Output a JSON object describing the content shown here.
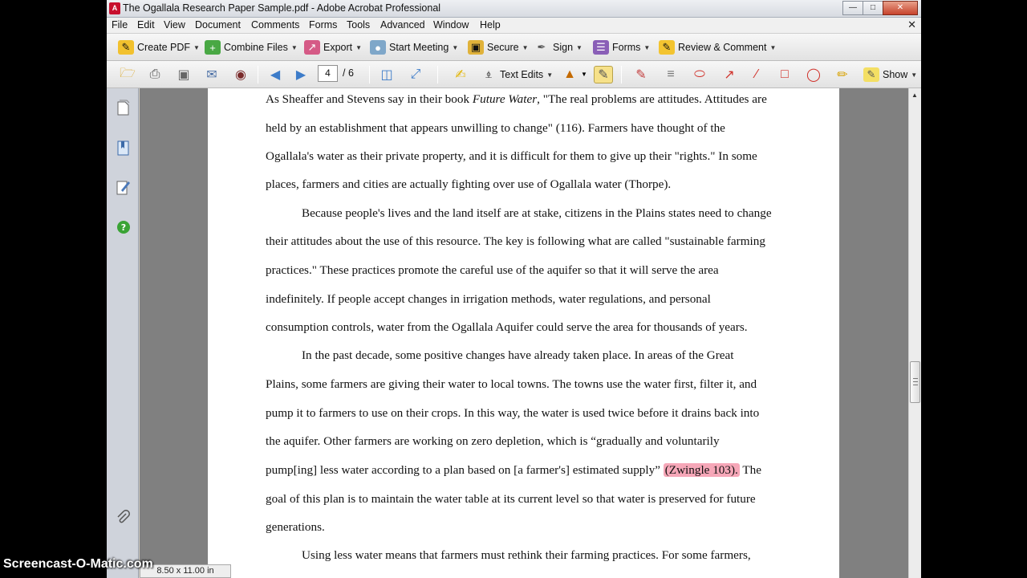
{
  "window": {
    "title": "The Ogallala Research Paper Sample.pdf - Adobe Acrobat Professional"
  },
  "menu": [
    "File",
    "Edit",
    "View",
    "Document",
    "Comments",
    "Forms",
    "Tools",
    "Advanced",
    "Window",
    "Help"
  ],
  "toolbar1": {
    "create_pdf": "Create PDF",
    "combine_files": "Combine Files",
    "export": "Export",
    "start_meeting": "Start Meeting",
    "secure": "Secure",
    "sign": "Sign",
    "forms": "Forms",
    "review_comment": "Review & Comment"
  },
  "toolbar2": {
    "page_current": "4",
    "page_total": "/ 6",
    "text_edits": "Text Edits",
    "show": "Show"
  },
  "document": {
    "lines": [
      "As Sheaffer and Stevens say in their book ",
      "held by an establishment that appears unwilling to change\" (116).  Farmers have thought of the",
      "Ogallala's water as their private property, and it is difficult for them to give up their \"rights.\"  In some",
      "places, farmers and cities are actually fighting over use of Ogallala water (Thorpe).",
      "Because people's lives and the land itself are at stake, citizens in the Plains states need to change",
      "their attitudes about the use of this resource.  The key is following what are called \"sustainable farming",
      "practices.\"  These practices promote the careful use of the aquifer so that it will serve the area",
      "indefinitely.  If people accept changes in irrigation methods, water regulations, and personal",
      "consumption controls, water from the Ogallala Aquifer could serve the area for thousands of years.",
      "In the past decade, some positive changes have already taken place.  In areas of the Great",
      "Plains, some farmers are giving their water to local towns.  The towns use the water first, filter it, and",
      "pump it to farmers to use on their crops.  In this way, the water is used twice before it drains back into",
      "the aquifer.  Other farmers are working on zero depletion, which is “gradually and voluntarily",
      "pump[ing] less water according to a plan based on [a farmer's] estimated supply” ",
      "goal of this plan is to maintain the water table at its current level so that water is preserved for future",
      "generations.",
      "Using less water means that farmers must rethink their farming practices.  For some farmers,"
    ],
    "line0_italic": "Future Water",
    "line0_rest": ", \"The real problems are attitudes.  Attitudes are",
    "line13_highlight": "(Zwingle 103).",
    "line13_rest": "  The"
  },
  "status": {
    "page_size": "8.50 x 11.00 in"
  },
  "watermark": "Screencast-O-Matic.com"
}
